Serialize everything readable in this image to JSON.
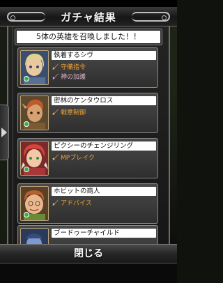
{
  "header": {
    "title": "ガチャ結果"
  },
  "summary": {
    "text": "5体の英雄を召喚しました！！"
  },
  "heroes": [
    {
      "name": "執着するシヴ",
      "skills": [
        "守備指令",
        "神の加護"
      ]
    },
    {
      "name": "密林のケンタウロス",
      "skills": [
        "戦意制御"
      ]
    },
    {
      "name": "ピクシーのチェンジリング",
      "skills": [
        "MPブレイク"
      ]
    },
    {
      "name": "ホビットの商人",
      "skills": [
        "アドバイス"
      ]
    },
    {
      "name": "ブードゥーチャイルド",
      "skills": []
    }
  ],
  "footer": {
    "close_label": "閉じる"
  },
  "colors": {
    "skill": "#f2a233",
    "panel": "#2e2e2e",
    "frame": "#8a8a8a"
  }
}
